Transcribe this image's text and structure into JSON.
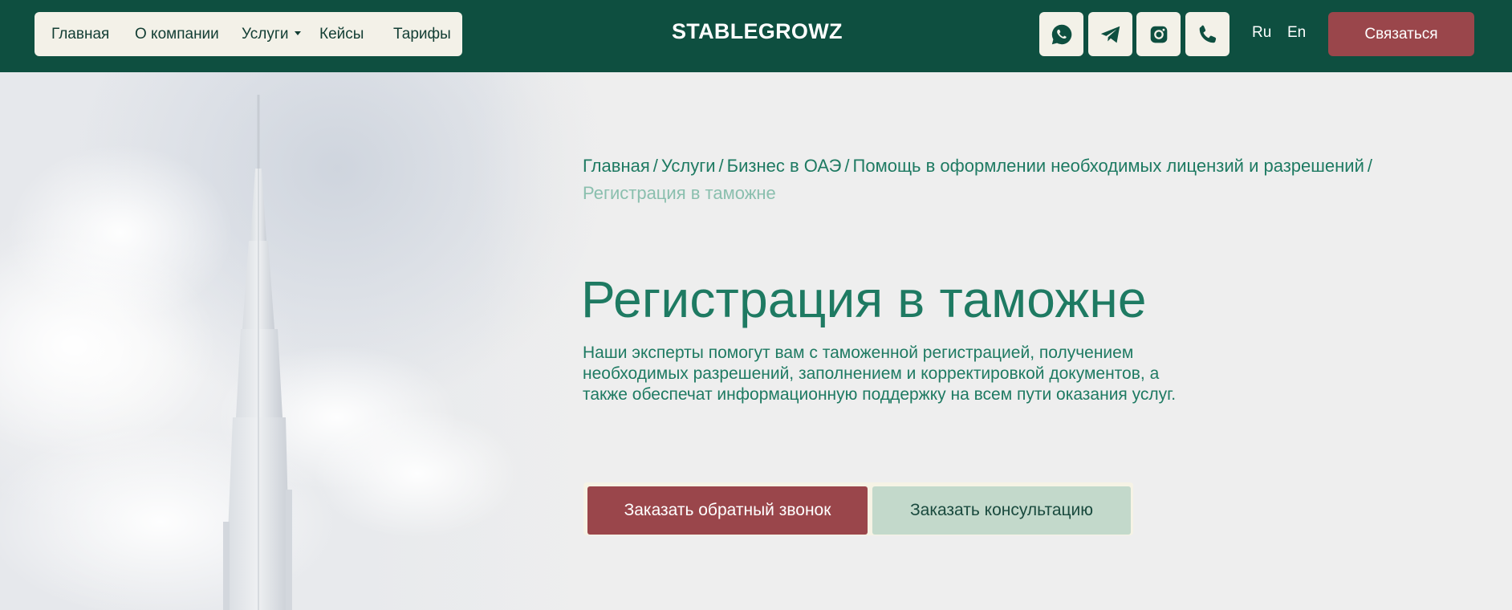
{
  "header": {
    "nav": [
      "Главная",
      "О компании",
      "Услуги",
      "Кейсы",
      "Тарифы"
    ],
    "logo": "STABLEGROWZ",
    "social": [
      "whatsapp-icon",
      "telegram-icon",
      "instagram-icon",
      "phone-icon"
    ],
    "lang_ru": "Ru",
    "lang_en": "En",
    "contact_label": "Связаться"
  },
  "breadcrumb": {
    "items": [
      "Главная",
      "Услуги",
      "Бизнес в ОАЭ",
      "Помощь в оформлении необходимых лицензий и разрешений"
    ],
    "separator": "/",
    "current": "Регистрация в таможне"
  },
  "hero": {
    "title": "Регистрация в таможне",
    "text": "Наши эксперты помогут вам с таможенной регистрацией, получением необходимых разрешений, заполнением и корректировкой документов, а также обеспечат информационную поддержку на всем пути оказания услуг.",
    "cta_primary": "Заказать обратный звонок",
    "cta_secondary": "Заказать консультацию"
  },
  "colors": {
    "header_bg": "#0e4f40",
    "accent_red": "#9a464b",
    "accent_green": "#1e7a62",
    "pill_bg": "#f3f1e8",
    "secondary_btn": "#c3d9cb"
  }
}
